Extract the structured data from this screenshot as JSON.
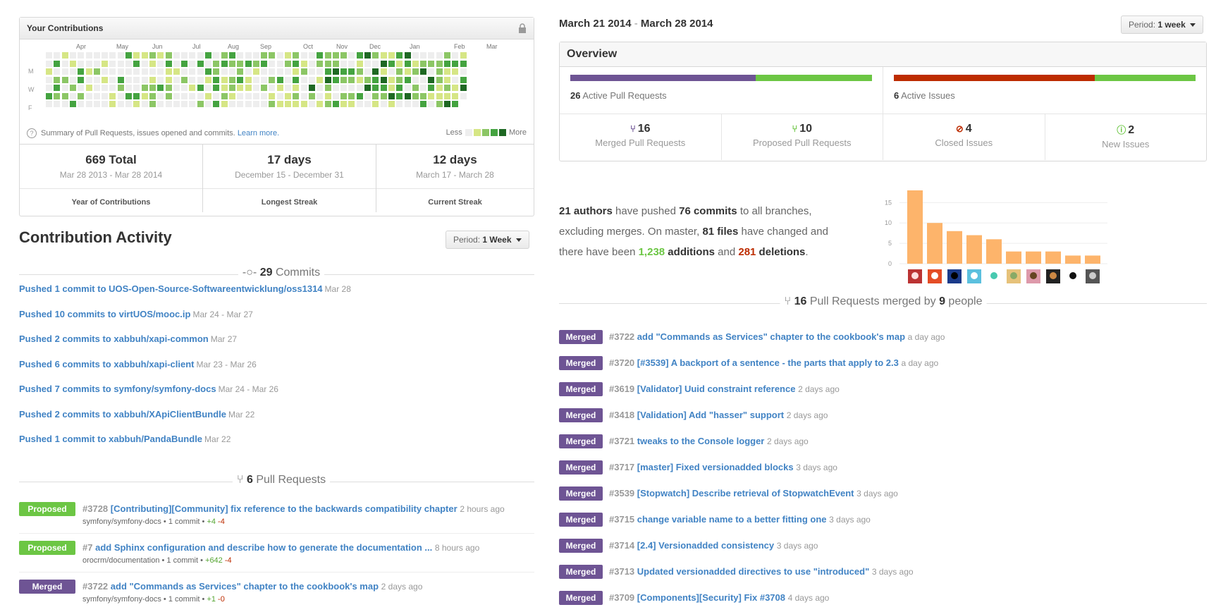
{
  "contributions": {
    "header": "Your Contributions",
    "months": [
      "Apr",
      "May",
      "Jun",
      "Jul",
      "Aug",
      "Sep",
      "Oct",
      "Nov",
      "Dec",
      "Jan",
      "Feb",
      "Mar"
    ],
    "day_labels": [
      "M",
      "W",
      "F"
    ],
    "summary_text": "Summary of Pull Requests, issues opened and commits.",
    "learn_more": "Learn more.",
    "legend_less": "Less",
    "legend_more": "More",
    "legend_colors": [
      "#eeeeee",
      "#d6e685",
      "#8cc665",
      "#44a340",
      "#1e6823"
    ],
    "stats": [
      {
        "big": "669 Total",
        "range": "Mar 28 2013 - Mar 28 2014",
        "label": "Year of Contributions"
      },
      {
        "big": "17 days",
        "range": "December 15 - December 31",
        "label": "Longest Streak"
      },
      {
        "big": "12 days",
        "range": "March 17 - March 28",
        "label": "Current Streak"
      }
    ]
  },
  "activity": {
    "title": "Contribution Activity",
    "period_prefix": "Period:",
    "period_value": "1 Week",
    "commits_count": "29",
    "commits_label": "Commits",
    "commits": [
      {
        "text": "Pushed 1 commit to UOS-Open-Source-Softwareentwicklung/oss1314",
        "date": "Mar 28"
      },
      {
        "text": "Pushed 10 commits to virtUOS/mooc.ip",
        "date": "Mar 24 - Mar 27"
      },
      {
        "text": "Pushed 2 commits to xabbuh/xapi-common",
        "date": "Mar 27"
      },
      {
        "text": "Pushed 6 commits to xabbuh/xapi-client",
        "date": "Mar 23 - Mar 26"
      },
      {
        "text": "Pushed 7 commits to symfony/symfony-docs",
        "date": "Mar 24 - Mar 26"
      },
      {
        "text": "Pushed 2 commits to xabbuh/XApiClientBundle",
        "date": "Mar 22"
      },
      {
        "text": "Pushed 1 commit to xabbuh/PandaBundle",
        "date": "Mar 22"
      }
    ],
    "pr_count": "6",
    "pr_label": "Pull Requests",
    "pull_requests": [
      {
        "state": "Proposed",
        "num": "#3728",
        "title": "[Contributing][Community] fix reference to the backwards compatibility chapter",
        "time": "2 hours ago",
        "repo": "symfony/symfony-docs",
        "commits": "1 commit",
        "add": "+4",
        "del": "-4"
      },
      {
        "state": "Proposed",
        "num": "#7",
        "title": "add Sphinx configuration and describe how to generate the documentation ...",
        "time": "8 hours ago",
        "repo": "orocrm/documentation",
        "commits": "1 commit",
        "add": "+642",
        "del": "-4"
      },
      {
        "state": "Merged",
        "num": "#3722",
        "title": "add \"Commands as Services\" chapter to the cookbook's map",
        "time": "2 days ago",
        "repo": "symfony/symfony-docs",
        "commits": "1 commit",
        "add": "+1",
        "del": "-0"
      }
    ]
  },
  "pulse": {
    "range_start": "March 21 2014",
    "range_sep": "-",
    "range_end": "March 28 2014",
    "period_prefix": "Period:",
    "period_value": "1 week",
    "overview_title": "Overview",
    "pr_bar": {
      "merged_fraction": 0.615,
      "color_a": "#6e5494",
      "color_b": "#6cc644"
    },
    "issue_bar": {
      "closed_fraction": 0.667,
      "color_a": "#bd2c00",
      "color_b": "#6cc644"
    },
    "active_prs_count": "26",
    "active_prs_label": "Active Pull Requests",
    "active_issues_count": "6",
    "active_issues_label": "Active Issues",
    "cells": [
      {
        "icon": "merged-pr-icon",
        "glyph": "⑂",
        "color": "#6e5494",
        "num": "16",
        "label": "Merged Pull Requests"
      },
      {
        "icon": "proposed-pr-icon",
        "glyph": "⑂",
        "color": "#6cc644",
        "num": "10",
        "label": "Proposed Pull Requests"
      },
      {
        "icon": "closed-issue-icon",
        "glyph": "⊘",
        "color": "#bd2c00",
        "num": "4",
        "label": "Closed Issues"
      },
      {
        "icon": "new-issue-icon",
        "glyph": "ⓘ",
        "color": "#6cc644",
        "num": "2",
        "label": "New Issues"
      }
    ],
    "summary": {
      "authors": "21 authors",
      "t1": " have pushed ",
      "commits": "76 commits",
      "t2": " to all branches, excluding merges. On master, ",
      "files": "81 files",
      "t3": " have changed and there have been ",
      "additions": "1,238",
      "t4": " additions",
      "t5": " and ",
      "deletions": "281",
      "t6": " deletions",
      "t7": "."
    },
    "merged_count": "16",
    "merged_label": "Pull Requests merged by",
    "people_count": "9",
    "people_label": "people",
    "merged_prs": [
      {
        "num": "#3722",
        "title": "add \"Commands as Services\" chapter to the cookbook's map",
        "time": "a day ago"
      },
      {
        "num": "#3720",
        "title": "[#3539] A backport of a sentence - the parts that apply to 2.3",
        "time": "a day ago"
      },
      {
        "num": "#3619",
        "title": "[Validator] Uuid constraint reference",
        "time": "2 days ago"
      },
      {
        "num": "#3418",
        "title": "[Validation] Add \"hasser\" support",
        "time": "2 days ago"
      },
      {
        "num": "#3721",
        "title": "tweaks to the Console logger",
        "time": "2 days ago"
      },
      {
        "num": "#3717",
        "title": "[master] Fixed versionadded blocks",
        "time": "3 days ago"
      },
      {
        "num": "#3539",
        "title": "[Stopwatch] Describe retrieval of StopwatchEvent",
        "time": "3 days ago"
      },
      {
        "num": "#3715",
        "title": "change variable name to a better fitting one",
        "time": "3 days ago"
      },
      {
        "num": "#3714",
        "title": "[2.4] Versionadded consistency",
        "time": "3 days ago"
      },
      {
        "num": "#3713",
        "title": "Updated versionadded directives to use \"introduced\"",
        "time": "3 days ago"
      },
      {
        "num": "#3709",
        "title": "[Components][Security] Fix #3708",
        "time": "4 days ago"
      }
    ],
    "merged_badge": "Merged"
  },
  "chart_data": {
    "type": "bar",
    "title": "",
    "xlabel": "",
    "ylabel": "",
    "ylim": [
      0,
      18
    ],
    "yticks": [
      0,
      5,
      10,
      15
    ],
    "categories": [
      "author-1",
      "author-2",
      "author-3",
      "author-4",
      "author-5",
      "author-6",
      "author-7",
      "author-8",
      "author-9",
      "author-10"
    ],
    "values": [
      18,
      10,
      8,
      7,
      6,
      3,
      3,
      3,
      2,
      2
    ],
    "color": "#fdb46b"
  }
}
